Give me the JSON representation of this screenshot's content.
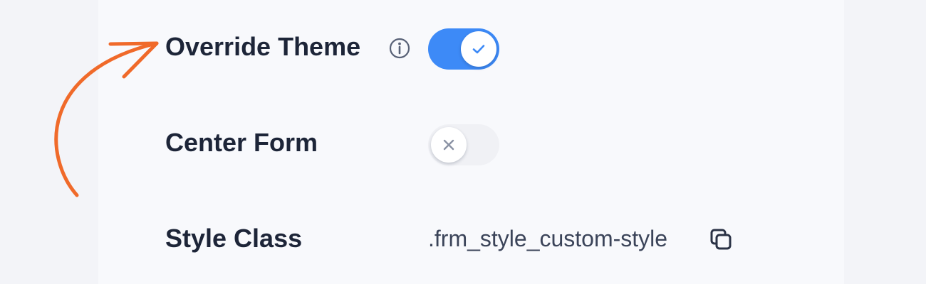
{
  "settings": {
    "override_theme": {
      "label": "Override Theme",
      "info_icon": "info-circle-icon",
      "toggle_state": "on",
      "toggle_icon": "check-icon"
    },
    "center_form": {
      "label": "Center Form",
      "toggle_state": "off",
      "toggle_icon": "x-icon"
    },
    "style_class": {
      "label": "Style Class",
      "value": ".frm_style_custom-style",
      "copy_icon": "copy-icon"
    }
  },
  "annotation": {
    "arrow_icon": "curved-arrow-icon",
    "arrow_color": "#f06a2a"
  },
  "colors": {
    "toggle_on": "#3d8af7",
    "toggle_off": "#f0f1f5",
    "label_text": "#1d2538",
    "panel_background": "#f8f9fc",
    "page_background": "#f3f4f8"
  }
}
